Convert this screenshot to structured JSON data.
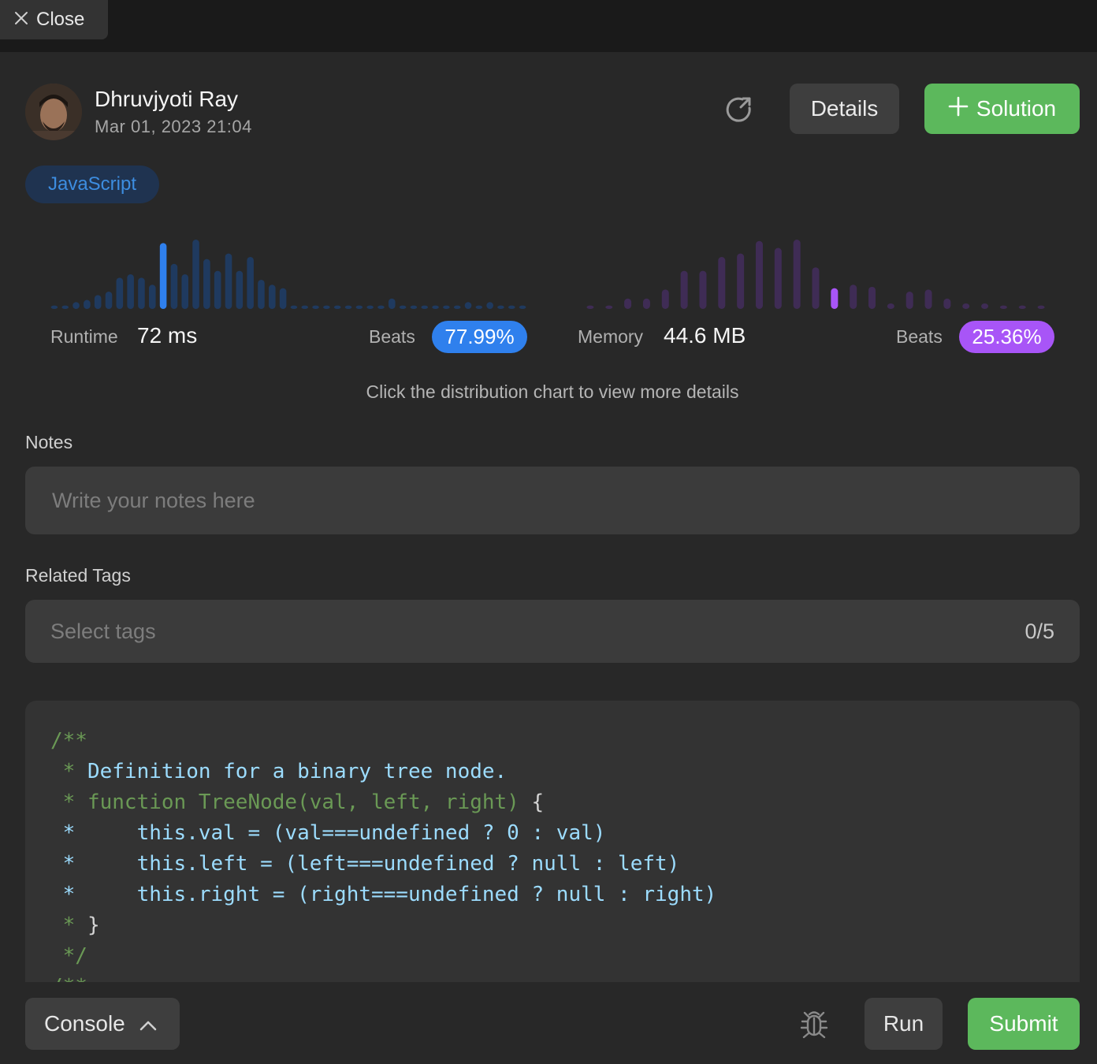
{
  "header": {
    "close_label": "Close"
  },
  "user": {
    "name": "Dhruvjyoti Ray",
    "date": "Mar 01, 2023 21:04"
  },
  "actions": {
    "details_label": "Details",
    "solution_label": "Solution"
  },
  "language": "JavaScript",
  "runtime": {
    "label": "Runtime",
    "value": "72 ms",
    "beats_label": "Beats",
    "beats_pct": "77.99%",
    "color": "#1f3a5f",
    "highlight_color": "#2f80ed",
    "highlight_index": 10,
    "distribution": [
      0.05,
      0.05,
      0.1,
      0.13,
      0.2,
      0.25,
      0.45,
      0.5,
      0.45,
      0.35,
      0.95,
      0.65,
      0.5,
      1.0,
      0.72,
      0.55,
      0.8,
      0.55,
      0.75,
      0.42,
      0.35,
      0.3,
      0.05,
      0.05,
      0.05,
      0.05,
      0.05,
      0.05,
      0.05,
      0.05,
      0.05,
      0.15,
      0.05,
      0.05,
      0.05,
      0.05,
      0.05,
      0.05,
      0.1,
      0.05,
      0.1,
      0.05,
      0.05,
      0.05
    ]
  },
  "memory": {
    "label": "Memory",
    "value": "44.6 MB",
    "beats_label": "Beats",
    "beats_pct": "25.36%",
    "color": "#3f2c55",
    "highlight_color": "#a855f7",
    "highlight_index": 13,
    "distribution": [
      0.05,
      0.05,
      0.15,
      0.15,
      0.28,
      0.55,
      0.55,
      0.75,
      0.8,
      0.98,
      0.88,
      1.0,
      0.6,
      0.3,
      0.35,
      0.32,
      0.08,
      0.25,
      0.28,
      0.15,
      0.08,
      0.08,
      0.05,
      0.05,
      0.05
    ]
  },
  "hint": "Click the distribution chart to view more details",
  "notes": {
    "label": "Notes",
    "placeholder": "Write your notes here"
  },
  "tags": {
    "label": "Related Tags",
    "placeholder": "Select tags",
    "count": "0/5"
  },
  "code": {
    "lines": [
      [
        {
          "t": "/**",
          "c": "green"
        }
      ],
      [
        {
          "t": " * ",
          "c": "green"
        },
        {
          "t": "Definition for a binary tree node.",
          "c": "blue"
        }
      ],
      [
        {
          "t": " * function TreeNode(val, left, right) ",
          "c": "green"
        },
        {
          "t": "{",
          "c": "white"
        }
      ],
      [
        {
          "t": " * ",
          "c": "blue"
        },
        {
          "t": "    this.val = (val===undefined ? 0 : val)",
          "c": "blue"
        }
      ],
      [
        {
          "t": " * ",
          "c": "blue"
        },
        {
          "t": "    this.left = (left===undefined ? null : left)",
          "c": "blue"
        }
      ],
      [
        {
          "t": " * ",
          "c": "blue"
        },
        {
          "t": "    this.right = (right===undefined ? null : right)",
          "c": "blue"
        }
      ],
      [
        {
          "t": " * ",
          "c": "green"
        },
        {
          "t": "}",
          "c": "white"
        }
      ],
      [
        {
          "t": " */",
          "c": "green"
        }
      ],
      [
        {
          "t": "/**",
          "c": "green"
        }
      ]
    ]
  },
  "footer": {
    "console_label": "Console",
    "run_label": "Run",
    "submit_label": "Submit"
  },
  "icons": {
    "close": "close-icon",
    "share": "share-icon",
    "plus": "plus-icon",
    "chevron": "chevron-up-icon",
    "bug": "bug-icon"
  },
  "colors": {
    "accent_green": "#5cb85c",
    "runtime_pill": "#2f80ed",
    "memory_pill": "#a855f7",
    "language_pill_bg": "#1f3350",
    "language_pill_text": "#3d8de0"
  }
}
